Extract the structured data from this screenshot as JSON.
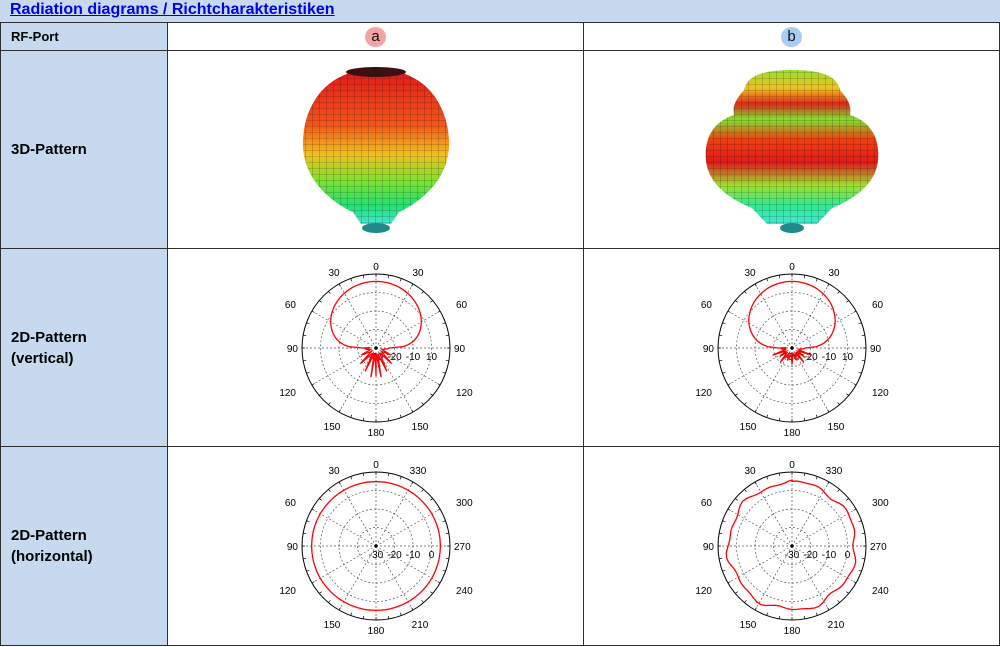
{
  "title": "Radiation diagrams / Richtcharakteristiken",
  "rows": {
    "rfport": "RF-Port",
    "pattern3d": "3D-Pattern",
    "vertical_line1": "2D-Pattern",
    "vertical_line2": "(vertical)",
    "horizontal_line1": "2D-Pattern",
    "horizontal_line2": "(horizontal)"
  },
  "ports": [
    {
      "label": "a",
      "color": "#f4a3a3"
    },
    {
      "label": "b",
      "color": "#a8cdf0"
    }
  ],
  "polar": {
    "radial_ticks": [
      "-30",
      "-20",
      "-10",
      "10"
    ],
    "radial_ticks_h": [
      "-30",
      "-20",
      "-10",
      "0"
    ],
    "vertical_angles": {
      "top": "0",
      "tl": "30",
      "tr": "30",
      "ml": "60",
      "mr": "60",
      "left": "90",
      "right": "90",
      "bl": "120",
      "br": "120",
      "bbl": "150",
      "bbr": "150",
      "bottom": "180"
    },
    "horizontal_angles": {
      "top": "0",
      "tl": "30",
      "tr": "330",
      "ml": "60",
      "mr": "300",
      "left": "90",
      "right": "270",
      "bl": "120",
      "br": "240",
      "bbl": "150",
      "bbr": "210",
      "bottom": "180"
    }
  },
  "colors": {
    "header_bg": "#c6d9ef",
    "trace": "#ff0000",
    "link": "#0000ee"
  }
}
